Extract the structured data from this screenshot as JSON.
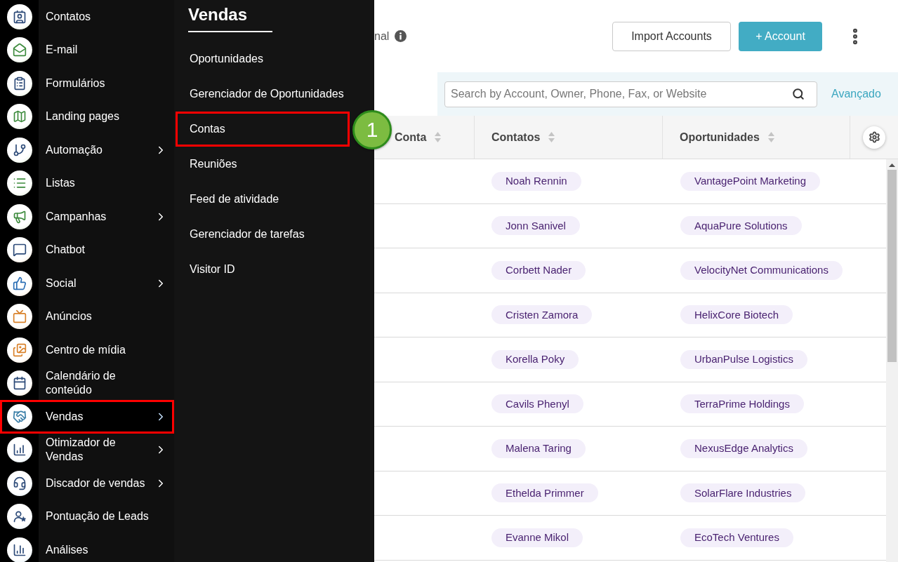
{
  "sidebar": {
    "items": [
      {
        "label": "Contatos",
        "has_submenu": false,
        "selected": false,
        "highlighted": false
      },
      {
        "label": "E-mail",
        "has_submenu": false,
        "selected": false,
        "highlighted": false
      },
      {
        "label": "Formulários",
        "has_submenu": false,
        "selected": false,
        "highlighted": false
      },
      {
        "label": "Landing pages",
        "has_submenu": false,
        "selected": false,
        "highlighted": false
      },
      {
        "label": "Automação",
        "has_submenu": true,
        "selected": false,
        "highlighted": false
      },
      {
        "label": "Listas",
        "has_submenu": false,
        "selected": false,
        "highlighted": false
      },
      {
        "label": "Campanhas",
        "has_submenu": true,
        "selected": false,
        "highlighted": false
      },
      {
        "label": "Chatbot",
        "has_submenu": false,
        "selected": false,
        "highlighted": false
      },
      {
        "label": "Social",
        "has_submenu": true,
        "selected": false,
        "highlighted": false
      },
      {
        "label": "Anúncios",
        "has_submenu": false,
        "selected": false,
        "highlighted": false
      },
      {
        "label": "Centro de mídia",
        "has_submenu": false,
        "selected": false,
        "highlighted": false
      },
      {
        "label": "Calendário de conteúdo",
        "has_submenu": false,
        "selected": false,
        "highlighted": false
      },
      {
        "label": "Vendas",
        "has_submenu": true,
        "selected": true,
        "highlighted": true
      },
      {
        "label": "Otimizador de Vendas",
        "has_submenu": true,
        "selected": false,
        "highlighted": false
      },
      {
        "label": "Discador de vendas",
        "has_submenu": true,
        "selected": false,
        "highlighted": false
      },
      {
        "label": "Pontuação de Leads",
        "has_submenu": false,
        "selected": false,
        "highlighted": false
      },
      {
        "label": "Análises",
        "has_submenu": false,
        "selected": false,
        "highlighted": false
      }
    ]
  },
  "submenu": {
    "title": "Vendas",
    "items": [
      {
        "label": "Oportunidades",
        "highlighted": false
      },
      {
        "label": "Gerenciador de Oportunidades",
        "highlighted": false
      },
      {
        "label": "Contas",
        "highlighted": true
      },
      {
        "label": "Reuniões",
        "highlighted": false
      },
      {
        "label": "Feed de atividade",
        "highlighted": false
      },
      {
        "label": "Gerenciador de tarefas",
        "highlighted": false
      },
      {
        "label": "Visitor ID",
        "highlighted": false
      }
    ]
  },
  "callout": {
    "label": "1"
  },
  "header": {
    "link_text": "nal",
    "buttons": [
      {
        "label": "Import Accounts",
        "kind": "outline"
      },
      {
        "label": "+ Account",
        "kind": "primary"
      }
    ]
  },
  "search": {
    "placeholder": "Search by Account, Owner, Phone, Fax, or Website",
    "advanced_link": "Avançado"
  },
  "table": {
    "columns": [
      {
        "label": "Conta"
      },
      {
        "label": "Contatos"
      },
      {
        "label": "Oportunidades"
      }
    ],
    "rows": [
      {
        "contact": "Noah Rennin",
        "opportunity": "VantagePoint Marketing"
      },
      {
        "contact": "Jonn Sanivel",
        "opportunity": "AquaPure Solutions"
      },
      {
        "contact": "Corbett Nader",
        "opportunity": "VelocityNet Communications"
      },
      {
        "contact": "Cristen Zamora",
        "opportunity": "HelixCore Biotech"
      },
      {
        "contact": "Korella Poky",
        "opportunity": "UrbanPulse Logistics"
      },
      {
        "contact": "Cavils Phenyl",
        "opportunity": "TerraPrime Holdings"
      },
      {
        "contact": "Malena Taring",
        "opportunity": "NexusEdge Analytics"
      },
      {
        "contact": "Ethelda Primmer",
        "opportunity": "SolarFlare Industries"
      },
      {
        "contact": "Evanne Mikol",
        "opportunity": "EcoTech Ventures"
      }
    ]
  }
}
